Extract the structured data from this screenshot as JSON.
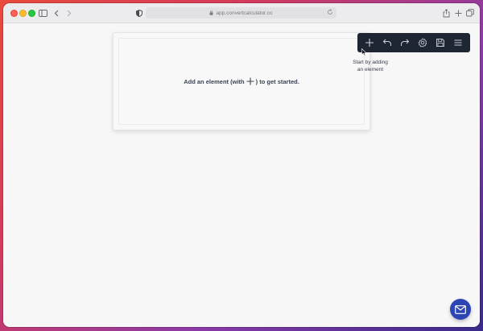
{
  "browser": {
    "url": "app.convertcalculator.co",
    "icons": {
      "sidebar": "sidebar-icon",
      "back": "chevron-left-icon",
      "forward": "chevron-right-icon",
      "shield": "shield-icon",
      "lock": "lock-icon",
      "reload": "reload-icon",
      "share": "share-icon",
      "new_tab": "plus-icon",
      "tabs": "tabs-icon"
    }
  },
  "canvas": {
    "empty_prefix": "Add an element (with",
    "empty_suffix": ") to get started."
  },
  "toolbar": {
    "items": [
      {
        "name": "add",
        "icon": "plus-icon"
      },
      {
        "name": "undo",
        "icon": "undo-icon"
      },
      {
        "name": "redo",
        "icon": "redo-icon"
      },
      {
        "name": "settings",
        "icon": "gear-icon"
      },
      {
        "name": "save",
        "icon": "save-icon"
      },
      {
        "name": "menu",
        "icon": "hamburger-icon"
      }
    ],
    "dark_color": "#1f2633"
  },
  "tooltip": {
    "line1": "Start by adding",
    "line2": "an element"
  },
  "support": {
    "icon": "mail-icon",
    "color": "#2d45b4"
  }
}
